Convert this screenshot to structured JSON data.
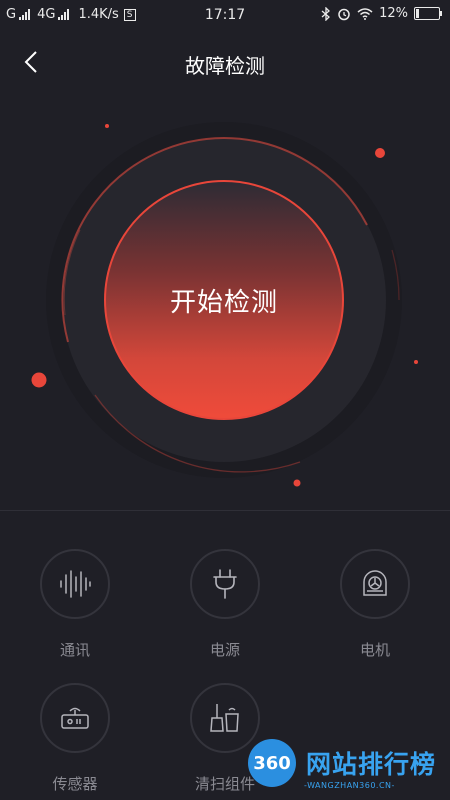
{
  "status_bar": {
    "carrier1": "G",
    "carrier2": "4G",
    "speed": "1.4K/s",
    "speed_icon_letter": "S",
    "time": "17:17",
    "battery_percent": "12%",
    "battery_level": 0.12
  },
  "header": {
    "title": "故障检测"
  },
  "main": {
    "start_label": "开始检测"
  },
  "categories": [
    {
      "label": "通讯",
      "icon": "waveform-icon"
    },
    {
      "label": "电源",
      "icon": "plug-icon"
    },
    {
      "label": "电机",
      "icon": "motor-icon"
    },
    {
      "label": "传感器",
      "icon": "sensor-icon"
    },
    {
      "label": "清扫组件",
      "icon": "cleaning-kit-icon"
    }
  ],
  "watermark": {
    "logo_text": "360",
    "title": "网站排行榜",
    "subtitle": "-WANGZHAN360.CN-"
  },
  "colors": {
    "background": "#1f1f26",
    "accent": "#e8463a",
    "watermark_blue": "#2b8fe0"
  }
}
